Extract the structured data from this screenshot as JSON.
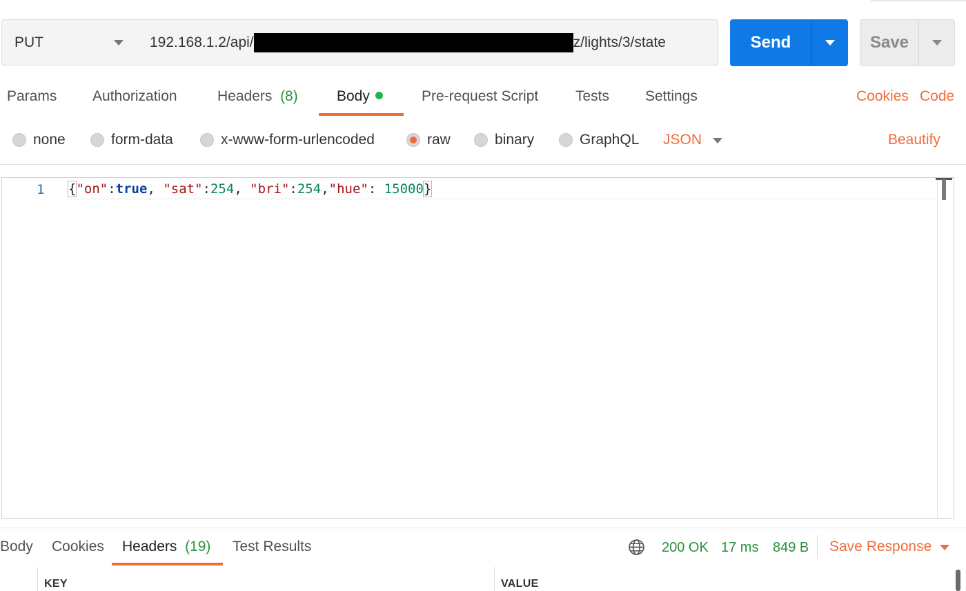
{
  "request": {
    "method": "PUT",
    "url_prefix": "192.168.1.2/api/",
    "url_suffix": "z/lights/3/state",
    "send_label": "Send",
    "save_label": "Save"
  },
  "request_tabs": {
    "params": "Params",
    "authorization": "Authorization",
    "headers": "Headers",
    "headers_count": "(8)",
    "body": "Body",
    "pre_request": "Pre-request Script",
    "tests": "Tests",
    "settings": "Settings",
    "cookies": "Cookies",
    "code": "Code"
  },
  "body_types": {
    "none": "none",
    "form_data": "form-data",
    "urlencoded": "x-www-form-urlencoded",
    "raw": "raw",
    "binary": "binary",
    "graphql": "GraphQL",
    "selected": "raw",
    "format": "JSON",
    "beautify": "Beautify"
  },
  "editor": {
    "line_number": "1",
    "tokens": {
      "open": "{",
      "k1": "\"on\"",
      "c1": ":",
      "v1": "true",
      "s1": ", ",
      "k2": "\"sat\"",
      "c2": ":",
      "v2": "254",
      "s2": ", ",
      "k3": "\"bri\"",
      "c3": ":",
      "v3": "254",
      "s3": ",",
      "k4": "\"hue\"",
      "c4": ": ",
      "v4": "15000",
      "close": "}"
    }
  },
  "response": {
    "tabs": {
      "body": "Body",
      "cookies": "Cookies",
      "headers": "Headers",
      "headers_count": "(19)",
      "test_results": "Test Results"
    },
    "status": "200 OK",
    "time": "17 ms",
    "size": "849 B",
    "save_response": "Save Response",
    "columns": {
      "key": "KEY",
      "value": "VALUE"
    }
  },
  "colors": {
    "accent": "#f26b3a",
    "send": "#0f7ae5",
    "success": "#26913d"
  }
}
